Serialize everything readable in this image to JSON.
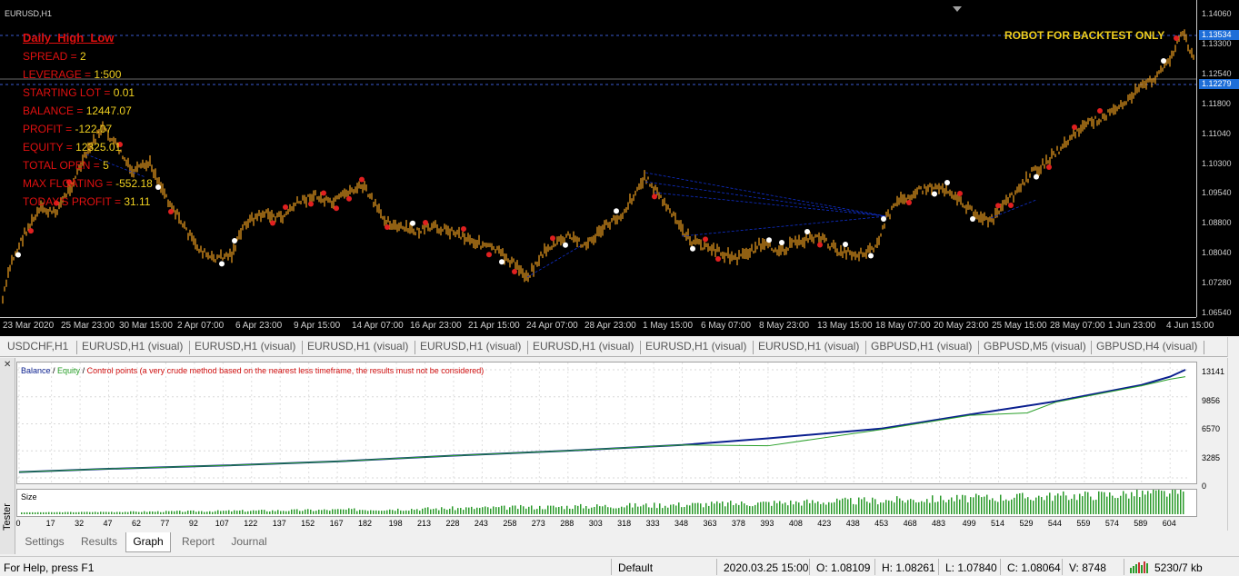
{
  "chart": {
    "title": "EURUSD,H1",
    "robot_label": "ROBOT FOR BACKTEST ONLY",
    "overlay": {
      "ea_name": "Daily_High_Low",
      "rows": [
        {
          "label": "SPREAD = ",
          "value": "2"
        },
        {
          "label": "LEVERAGE = ",
          "value": "1:500"
        },
        {
          "label": "STARTING LOT = ",
          "value": "0.01"
        },
        {
          "label": "BALANCE = ",
          "value": "12447.07"
        },
        {
          "label": "PROFIT = ",
          "value": "-122.07"
        },
        {
          "label": "EQUITY = ",
          "value": "12325.01"
        },
        {
          "label": "TOTAL OPEN = ",
          "value": "5"
        },
        {
          "label": "MAX FLOATING = ",
          "value": "-552.18"
        },
        {
          "label": "TODAY'S PROFIT = ",
          "value": "31.11"
        }
      ]
    },
    "price_axis": [
      "1.14060",
      "1.13300",
      "1.12540",
      "1.11800",
      "1.11040",
      "1.10300",
      "1.09540",
      "1.08800",
      "1.08040",
      "1.07280",
      "1.06540"
    ],
    "price_boxes": [
      "1.13534",
      "1.12279"
    ],
    "time_axis": [
      "23 Mar 2020",
      "25 Mar 23:00",
      "30 Mar 15:00",
      "2 Apr 07:00",
      "6 Apr 23:00",
      "9 Apr 15:00",
      "14 Apr 07:00",
      "16 Apr 23:00",
      "21 Apr 15:00",
      "24 Apr 07:00",
      "28 Apr 23:00",
      "1 May 15:00",
      "6 May 07:00",
      "8 May 23:00",
      "13 May 15:00",
      "18 May 07:00",
      "20 May 23:00",
      "25 May 15:00",
      "28 May 07:00",
      "1 Jun 23:00",
      "4 Jun 15:00"
    ],
    "colors": {
      "background": "#000000",
      "candles": "#f0a020",
      "buy_arrow": "#e02020",
      "sell_arrow": "#ffffff",
      "order_line": "#1030d0"
    }
  },
  "chart_tabs": [
    "USDCHF,H1",
    "EURUSD,H1 (visual)",
    "EURUSD,H1 (visual)",
    "EURUSD,H1 (visual)",
    "EURUSD,H1 (visual)",
    "EURUSD,H1 (visual)",
    "EURUSD,H1 (visual)",
    "EURUSD,H1 (visual)",
    "GBPUSD,H1 (visual)",
    "GBPUSD,M5 (visual)",
    "GBPUSD,H4 (visual)"
  ],
  "tester": {
    "side_label": "Tester",
    "close_icon": "close-icon",
    "legend": {
      "balance": "Balance",
      "slash1": " / ",
      "equity": "Equity",
      "slash2": " / ",
      "control": "Control points (a very crude method based on the nearest less timeframe, the results must not be considered)"
    },
    "size_label": "Size",
    "balance_axis": [
      "13141",
      "9856",
      "6570",
      "3285",
      "0"
    ],
    "x_axis": [
      "0",
      "17",
      "32",
      "47",
      "62",
      "77",
      "92",
      "107",
      "122",
      "137",
      "152",
      "167",
      "182",
      "198",
      "213",
      "228",
      "243",
      "258",
      "273",
      "288",
      "303",
      "318",
      "333",
      "348",
      "363",
      "378",
      "393",
      "408",
      "423",
      "438",
      "453",
      "468",
      "483",
      "499",
      "514",
      "529",
      "544",
      "559",
      "574",
      "589",
      "604"
    ],
    "tabs": [
      "Settings",
      "Results",
      "Graph",
      "Report",
      "Journal"
    ],
    "active_tab": "Graph",
    "colors": {
      "balance": "#0a1f8f",
      "equity": "#2aa02a",
      "control": "#d01010",
      "size": "#2a9a2a"
    }
  },
  "chart_data": [
    {
      "type": "line",
      "title": "",
      "series": [
        {
          "name": "Balance",
          "x": [
            0,
            47,
            107,
            167,
            228,
            288,
            348,
            393,
            453,
            499,
            544,
            589,
            604,
            612
          ],
          "values": [
            700,
            1100,
            1500,
            2000,
            2700,
            3300,
            4000,
            4800,
            6000,
            7700,
            9300,
            11300,
            12300,
            13141
          ]
        },
        {
          "name": "Equity",
          "x": [
            0,
            47,
            107,
            167,
            228,
            288,
            348,
            393,
            453,
            499,
            529,
            544,
            589,
            604,
            612
          ],
          "values": [
            700,
            1100,
            1500,
            2000,
            2700,
            3300,
            4000,
            3900,
            5900,
            7600,
            7900,
            9200,
            11200,
            12000,
            12300
          ]
        }
      ],
      "xlim": [
        0,
        612
      ],
      "ylim": [
        0,
        13141
      ],
      "grid": true
    },
    {
      "type": "bar",
      "title": "",
      "series": [
        {
          "name": "Size",
          "x_range": [
            0,
            612
          ],
          "values": "increasing"
        }
      ]
    }
  ],
  "status": {
    "help": "For Help, press F1",
    "profile": "Default",
    "datetime": "2020.03.25 15:00",
    "open": "O: 1.08109",
    "high": "H: 1.08261",
    "low": "L: 1.07840",
    "close": "C: 1.08064",
    "volume": "V: 8748",
    "traffic": "5230/7 kb"
  }
}
